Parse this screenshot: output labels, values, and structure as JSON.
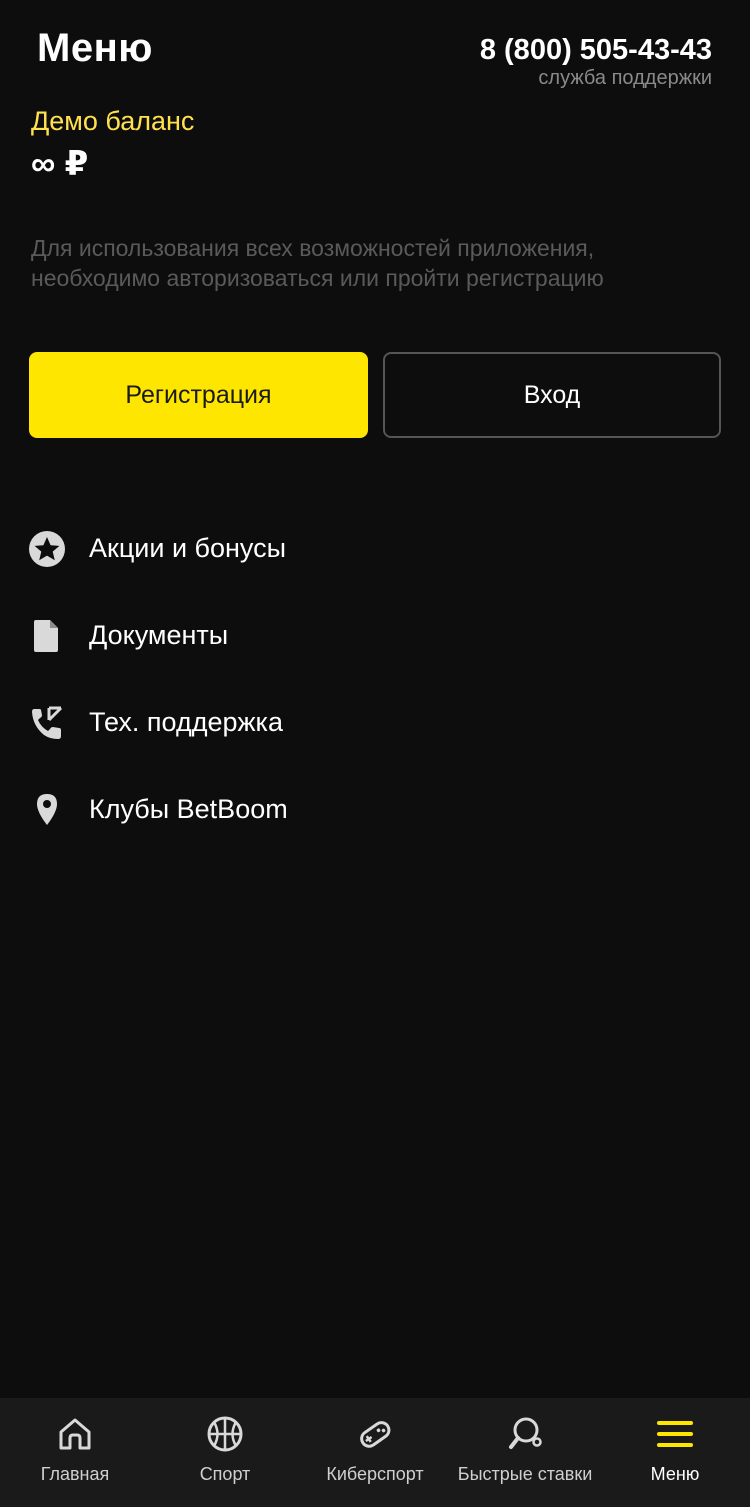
{
  "header": {
    "title": "Меню",
    "phone": "8 (800) 505-43-43",
    "phone_caption": "служба поддержки"
  },
  "balance": {
    "label": "Демо баланс",
    "value": "∞ ₽",
    "label_color": "#ffe14d"
  },
  "auth": {
    "note": "Для использования всех возможностей приложения, необходимо авторизоваться или пройти регистрацию",
    "register_label": "Регистрация",
    "login_label": "Вход",
    "accent_color": "#ffe600"
  },
  "menu": {
    "items": [
      {
        "label": "Акции и бонусы",
        "icon": "star-badge-icon"
      },
      {
        "label": "Документы",
        "icon": "document-icon"
      },
      {
        "label": "Тех. поддержка",
        "icon": "phone-call-icon"
      },
      {
        "label": "Клубы BetBoom",
        "icon": "location-pin-icon"
      }
    ]
  },
  "bottom_nav": {
    "active_index": 4,
    "tabs": [
      {
        "label": "Главная",
        "icon": "home-icon"
      },
      {
        "label": "Спорт",
        "icon": "basketball-icon"
      },
      {
        "label": "Киберспорт",
        "icon": "gamepad-icon"
      },
      {
        "label": "Быстрые ставки",
        "icon": "ping-pong-icon"
      },
      {
        "label": "Меню",
        "icon": "menu-icon"
      }
    ]
  }
}
